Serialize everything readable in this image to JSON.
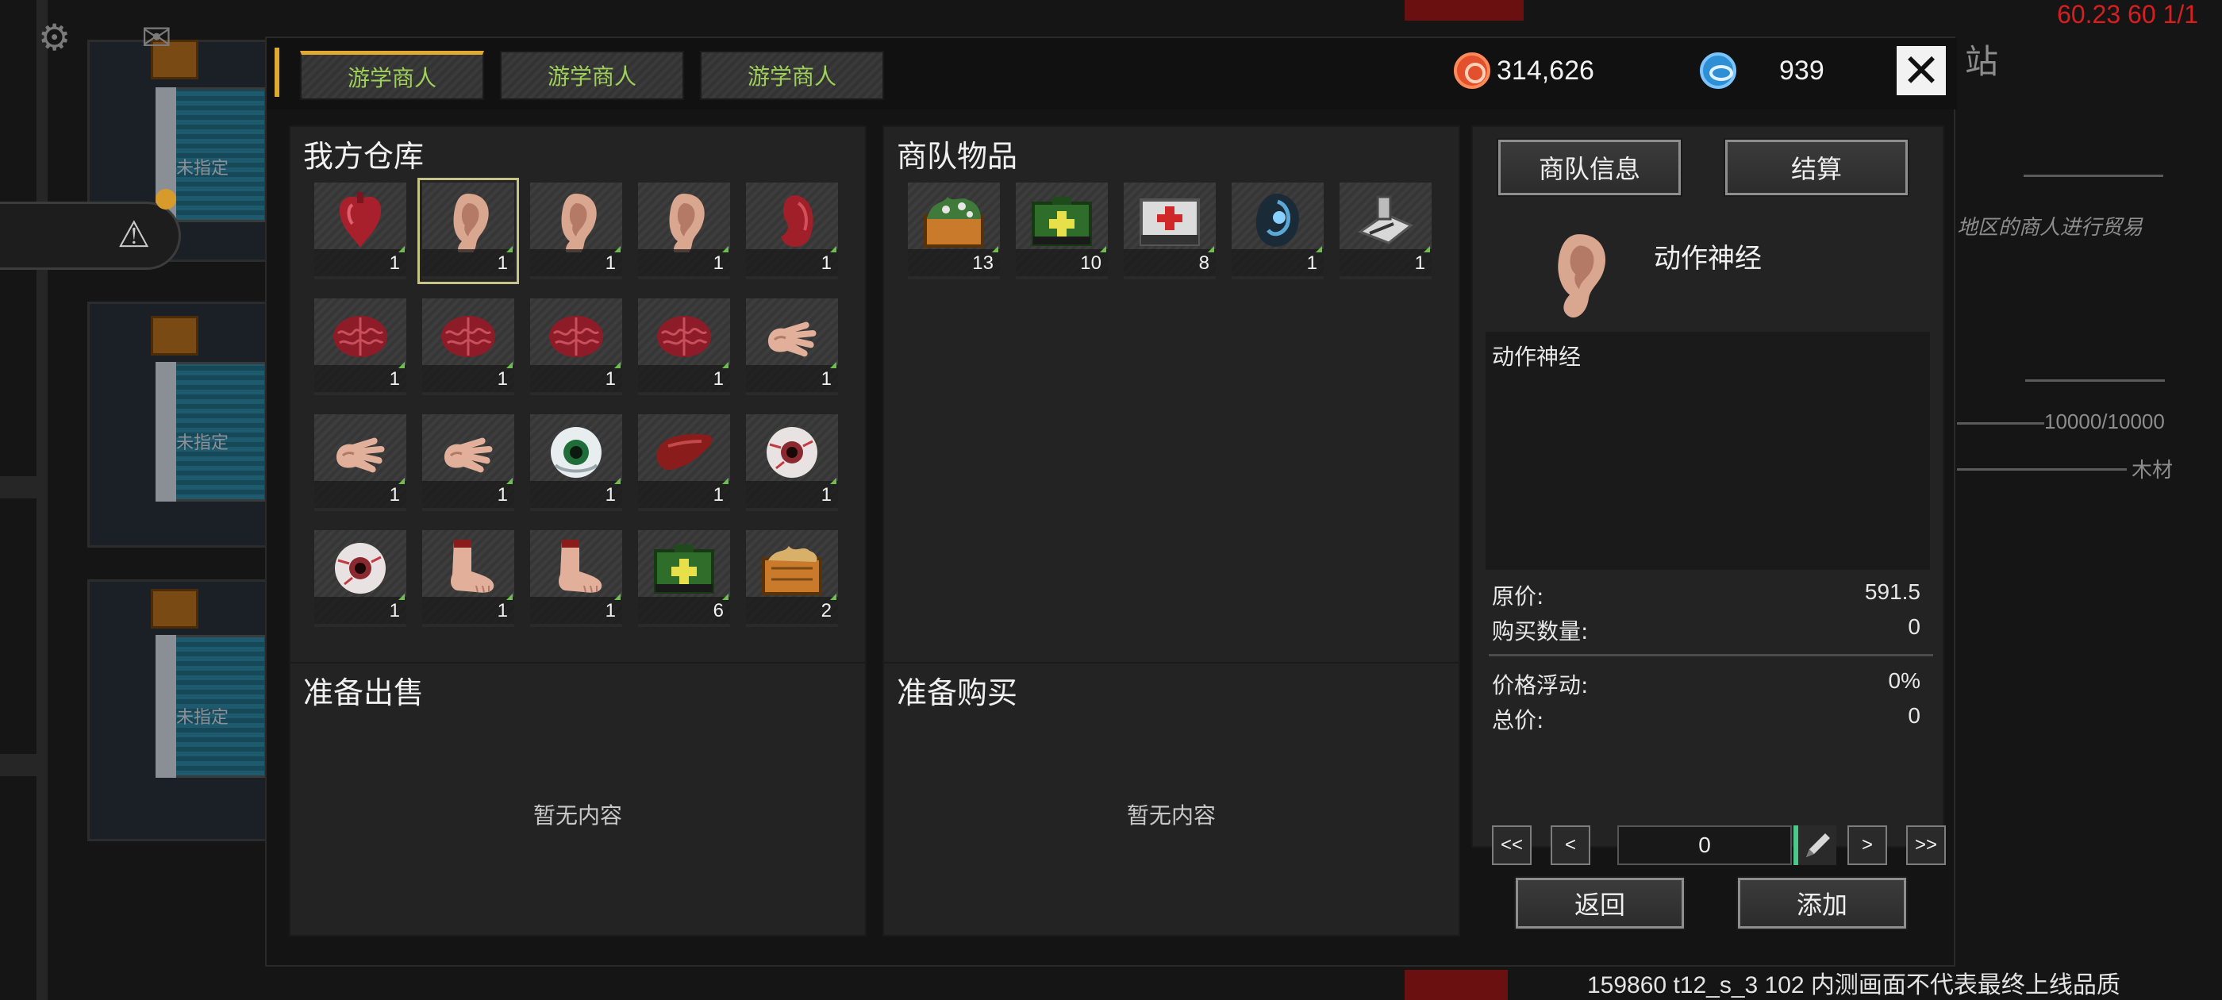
{
  "hud": {
    "fps_text": "60.23 60 1/1",
    "bottom_note": "159860 t12_s_3 102  内测画面不代表最终上线品质"
  },
  "world": {
    "unassigned_label": "未指定",
    "right_snippets": {
      "station_char": "站",
      "trade_hint": "地区的商人进行贸易",
      "capacity": "10000/10000",
      "material": "木材"
    }
  },
  "dialog": {
    "tabs": [
      {
        "label": "游学商人",
        "active": true
      },
      {
        "label": "游学商人",
        "active": false
      },
      {
        "label": "游学商人",
        "active": false
      }
    ],
    "currency": {
      "gold": "314,626",
      "gems": "939"
    },
    "close_symbol": "✕",
    "my_storage": {
      "title": "我方仓库",
      "items": [
        {
          "icon": "heart",
          "qty": "1"
        },
        {
          "icon": "ear",
          "qty": "1",
          "selected": true
        },
        {
          "icon": "ear",
          "qty": "1"
        },
        {
          "icon": "ear",
          "qty": "1"
        },
        {
          "icon": "kidney",
          "qty": "1"
        },
        {
          "icon": "brain",
          "qty": "1"
        },
        {
          "icon": "brain",
          "qty": "1"
        },
        {
          "icon": "brain",
          "qty": "1"
        },
        {
          "icon": "brain",
          "qty": "1"
        },
        {
          "icon": "hand",
          "qty": "1"
        },
        {
          "icon": "hand",
          "qty": "1"
        },
        {
          "icon": "hand",
          "qty": "1"
        },
        {
          "icon": "eye-green",
          "qty": "1"
        },
        {
          "icon": "liver",
          "qty": "1"
        },
        {
          "icon": "eye-red",
          "qty": "1"
        },
        {
          "icon": "eye-red",
          "qty": "1"
        },
        {
          "icon": "foot",
          "qty": "1"
        },
        {
          "icon": "foot",
          "qty": "1"
        },
        {
          "icon": "green-medkit",
          "qty": "6"
        },
        {
          "icon": "herb-crate",
          "qty": "2"
        }
      ]
    },
    "caravan_goods": {
      "title": "商队物品",
      "items": [
        {
          "icon": "herb-crate-green",
          "qty": "13"
        },
        {
          "icon": "green-medkit",
          "qty": "10"
        },
        {
          "icon": "white-medkit",
          "qty": "8"
        },
        {
          "icon": "blue-device",
          "qty": "1"
        },
        {
          "icon": "tool-kit",
          "qty": "1"
        }
      ]
    },
    "to_sell": {
      "title": "准备出售",
      "empty": "暂无内容"
    },
    "to_buy": {
      "title": "准备购买",
      "empty": "暂无内容"
    },
    "info": {
      "caravan_info_button": "商队信息",
      "settle_button": "结算",
      "item_name": "动作神经",
      "item_desc": "动作神经",
      "original_price_label": "原价:",
      "original_price": "591.5",
      "buy_qty_label": "购买数量:",
      "buy_qty": "0",
      "price_fluct_label": "价格浮动:",
      "price_fluct": "0%",
      "total_label": "总价:",
      "total": "0",
      "first_btn": "<<",
      "prev_btn": "<",
      "qty_value": "0",
      "next_btn": ">",
      "last_btn": ">>",
      "back_button": "返回",
      "add_button": "添加"
    }
  }
}
